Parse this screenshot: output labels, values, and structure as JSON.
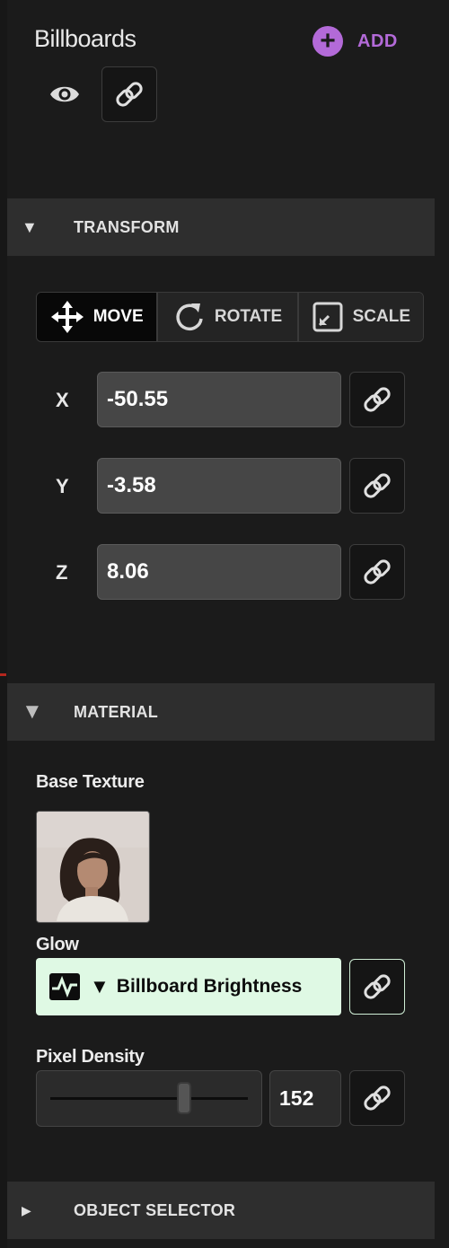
{
  "panel": {
    "title": "Billboards",
    "add_label": "ADD"
  },
  "transform": {
    "header": "TRANSFORM",
    "modes": [
      {
        "label": "MOVE",
        "icon": "move-icon",
        "active": true
      },
      {
        "label": "ROTATE",
        "icon": "rotate-icon",
        "active": false
      },
      {
        "label": "SCALE",
        "icon": "scale-icon",
        "active": false
      }
    ],
    "x": {
      "label": "X",
      "value": "-50.55"
    },
    "y": {
      "label": "Y",
      "value": "-3.58"
    },
    "z": {
      "label": "Z",
      "value": "8.06"
    }
  },
  "material": {
    "header": "MATERIAL",
    "base_texture_label": "Base Texture",
    "glow_label": "Glow",
    "glow_value": "Billboard Brightness",
    "pixel_density_label": "Pixel Density",
    "pixel_density_value": "152",
    "pixel_density_slider_fraction": 0.67
  },
  "object_selector": {
    "header": "OBJECT SELECTOR"
  },
  "colors": {
    "accent_purple": "#b36ad8",
    "glow_bg": "#dff9e4",
    "panel_bg": "#1b1b1b",
    "header_bg": "#2e2e2e"
  }
}
